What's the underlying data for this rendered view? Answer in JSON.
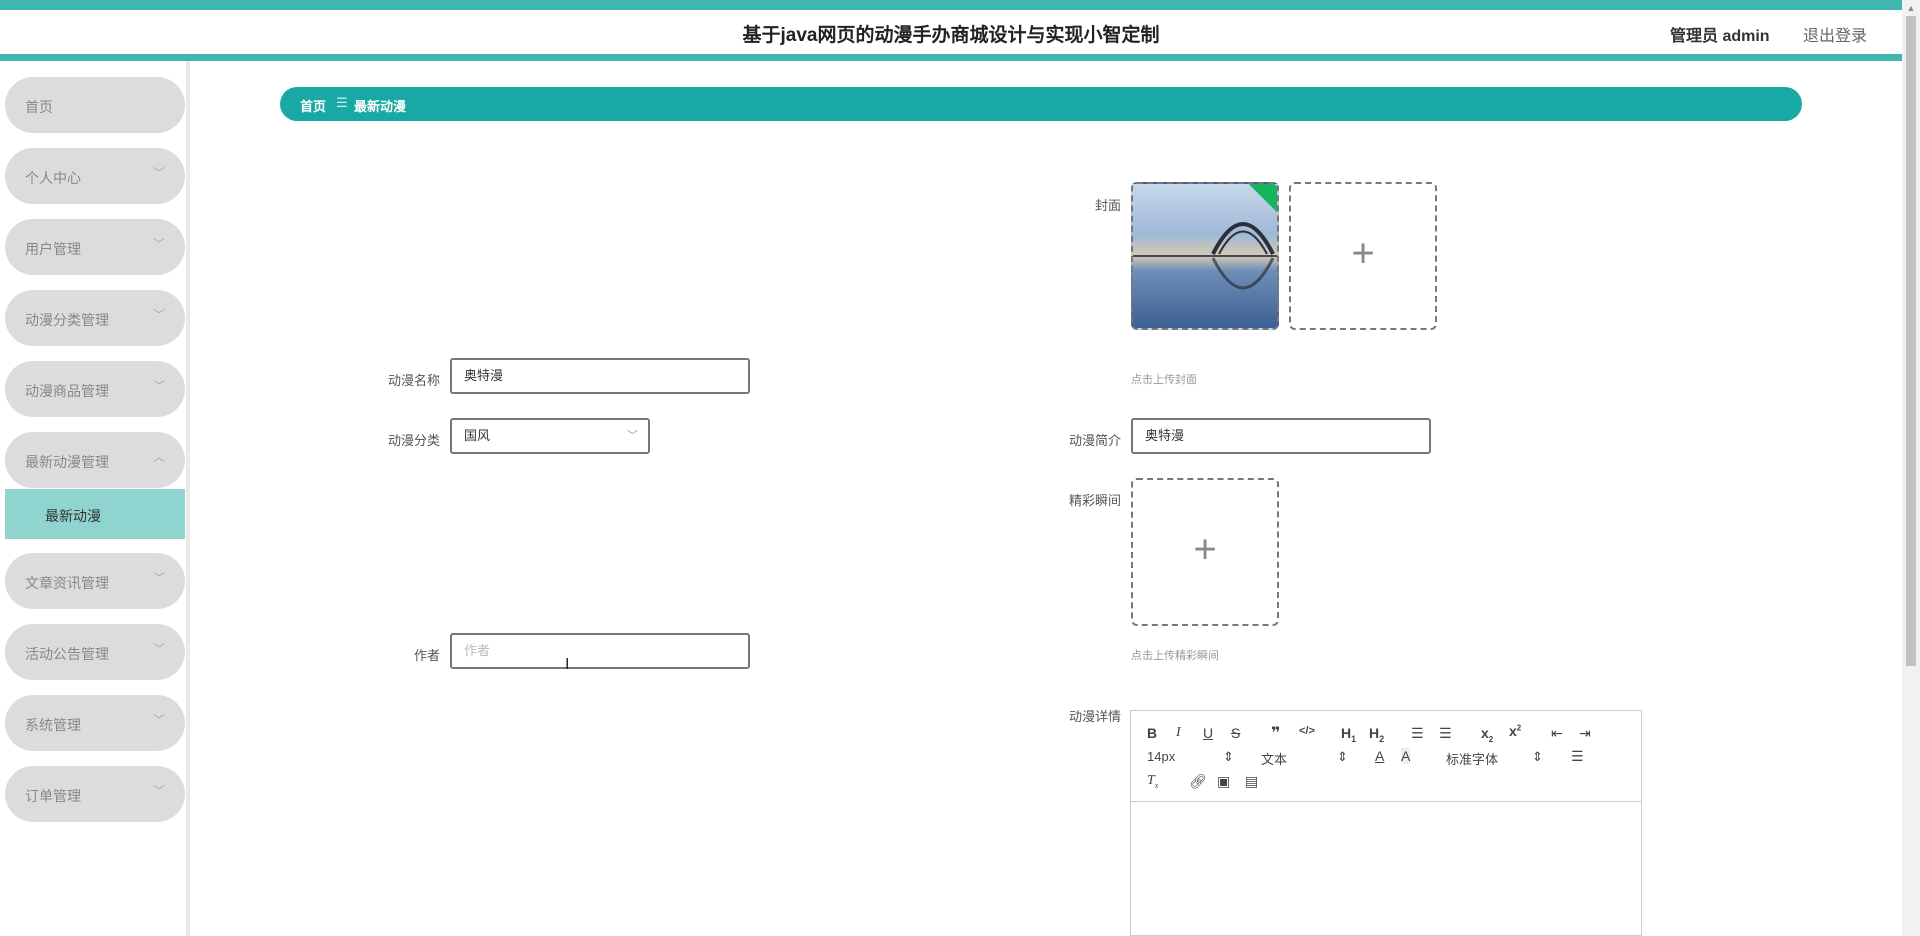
{
  "header": {
    "title": "基于java网页的动漫手办商城设计与实现小智定制",
    "admin": "管理员 admin",
    "logout": "退出登录"
  },
  "sidebar": {
    "items": [
      {
        "label": "首页"
      },
      {
        "label": "个人中心",
        "chevron": "﹀"
      },
      {
        "label": "用户管理",
        "chevron": "﹀"
      },
      {
        "label": "动漫分类管理",
        "chevron": "﹀"
      },
      {
        "label": "动漫商品管理",
        "chevron": "﹀"
      },
      {
        "label": "最新动漫管理",
        "chevron": "︿"
      },
      {
        "label": "文章资讯管理",
        "chevron": "﹀"
      },
      {
        "label": "活动公告管理",
        "chevron": "﹀"
      },
      {
        "label": "系统管理",
        "chevron": "﹀"
      },
      {
        "label": "订单管理",
        "chevron": "﹀"
      }
    ],
    "submenu": {
      "label": "最新动漫"
    }
  },
  "breadcrumb": {
    "home": "首页",
    "separator": "☰",
    "current": "最新动漫"
  },
  "form": {
    "cover": {
      "label": "封面",
      "hint": "点击上传封面"
    },
    "name": {
      "label": "动漫名称",
      "value": "奥特漫"
    },
    "category": {
      "label": "动漫分类",
      "value": "国风"
    },
    "intro": {
      "label": "动漫简介",
      "value": "奥特漫"
    },
    "highlights": {
      "label": "精彩瞬间",
      "hint": "点击上传精彩瞬间"
    },
    "author": {
      "label": "作者",
      "placeholder": "作者"
    },
    "details": {
      "label": "动漫详情"
    }
  },
  "editor": {
    "font_size": "14px",
    "block_type": "文本",
    "font_family": "标准字体"
  }
}
